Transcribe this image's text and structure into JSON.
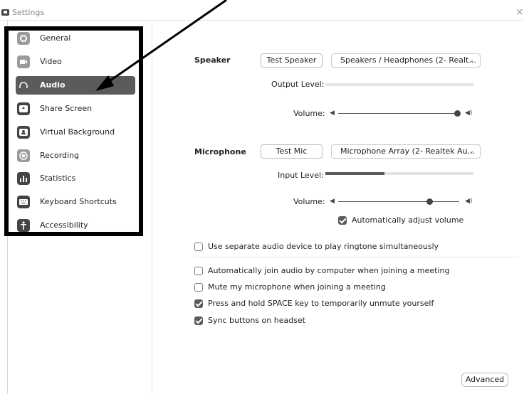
{
  "window": {
    "title": "Settings",
    "close_glyph": "×"
  },
  "sidebar": {
    "items": [
      {
        "label": "General",
        "icon": "gear-icon",
        "active": false
      },
      {
        "label": "Video",
        "icon": "video-icon",
        "active": false
      },
      {
        "label": "Audio",
        "icon": "headphones-icon",
        "active": true
      },
      {
        "label": "Share Screen",
        "icon": "share-screen-icon",
        "active": false
      },
      {
        "label": "Virtual Background",
        "icon": "virtual-background-icon",
        "active": false
      },
      {
        "label": "Recording",
        "icon": "recording-icon",
        "active": false
      },
      {
        "label": "Statistics",
        "icon": "statistics-icon",
        "active": false
      },
      {
        "label": "Keyboard Shortcuts",
        "icon": "keyboard-icon",
        "active": false
      },
      {
        "label": "Accessibility",
        "icon": "accessibility-icon",
        "active": false
      }
    ]
  },
  "speaker": {
    "label": "Speaker",
    "test_button": "Test Speaker",
    "device": "Speakers / Headphones (2- Realt...",
    "output_level_label": "Output Level:",
    "output_level": 0,
    "volume_label": "Volume:",
    "volume": 1.0
  },
  "microphone": {
    "label": "Microphone",
    "test_button": "Test Mic",
    "device": "Microphone Array (2- Realtek Au...",
    "input_level_label": "Input Level:",
    "input_level": 0.4,
    "volume_label": "Volume:",
    "volume": 0.75,
    "auto_adjust_label": "Automatically adjust volume",
    "auto_adjust_checked": true
  },
  "options": [
    {
      "label": "Use separate audio device to play ringtone simultaneously",
      "checked": false
    },
    {
      "label": "Automatically join audio by computer when joining a meeting",
      "checked": false
    },
    {
      "label": "Mute my microphone when joining a meeting",
      "checked": false
    },
    {
      "label": "Press and hold SPACE key to temporarily unmute yourself",
      "checked": true
    },
    {
      "label": "Sync buttons on headset",
      "checked": true
    }
  ],
  "advanced_button": "Advanced",
  "colors": {
    "active_item": "#5b5b5b",
    "frame": "#000000"
  }
}
